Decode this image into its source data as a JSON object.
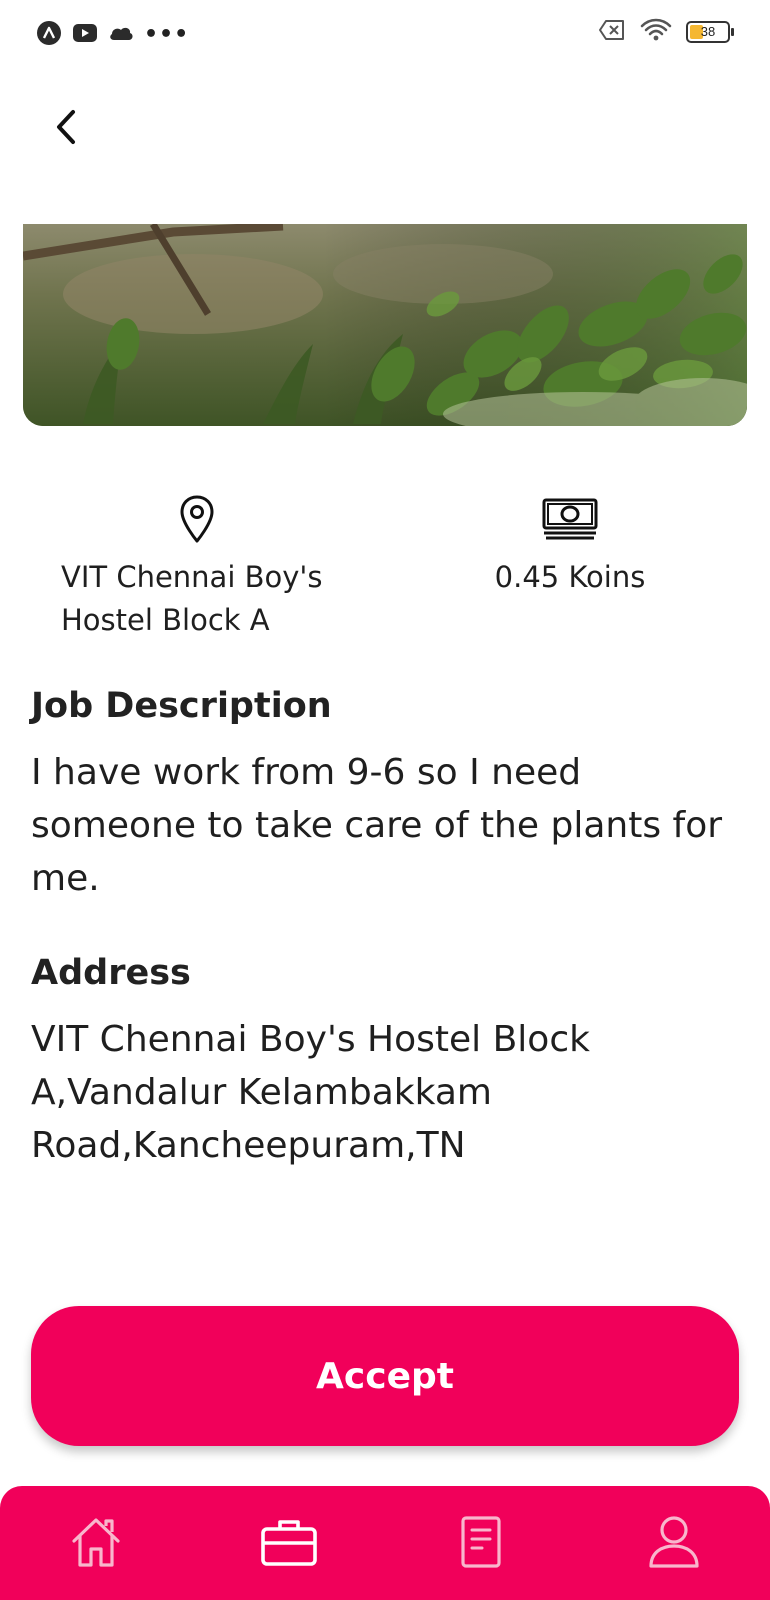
{
  "status_bar": {
    "left_icons": [
      "app-icon",
      "youtube-icon",
      "cloud-icon"
    ],
    "overflow": "•••",
    "right_icons": [
      "sim-off-icon",
      "wifi-icon"
    ],
    "battery_level": "38",
    "battery_fill_color": "#f5b731"
  },
  "header": {
    "back_icon": "chevron-left-icon"
  },
  "hero": {
    "image": "garden-plants-photo"
  },
  "info": {
    "location_icon": "map-pin-icon",
    "location_text": "VIT Chennai Boy's\nHostel Block A",
    "payment_icon": "banknote-icon",
    "payment_text": "0.45 Koins"
  },
  "job": {
    "heading": "Job Description",
    "body": "I have work from 9-6 so I need someone to take care of the plants for me."
  },
  "address": {
    "heading": "Address",
    "body": "VIT Chennai Boy's Hostel Block A,Vandalur Kelambakkam Road,Kancheepuram,TN"
  },
  "actions": {
    "accept_label": "Accept",
    "accent_color": "#f1005a"
  },
  "bottom_nav": {
    "items": [
      {
        "icon": "home-icon",
        "active": false
      },
      {
        "icon": "briefcase-icon",
        "active": true
      },
      {
        "icon": "document-icon",
        "active": false
      },
      {
        "icon": "user-icon",
        "active": false
      }
    ]
  }
}
